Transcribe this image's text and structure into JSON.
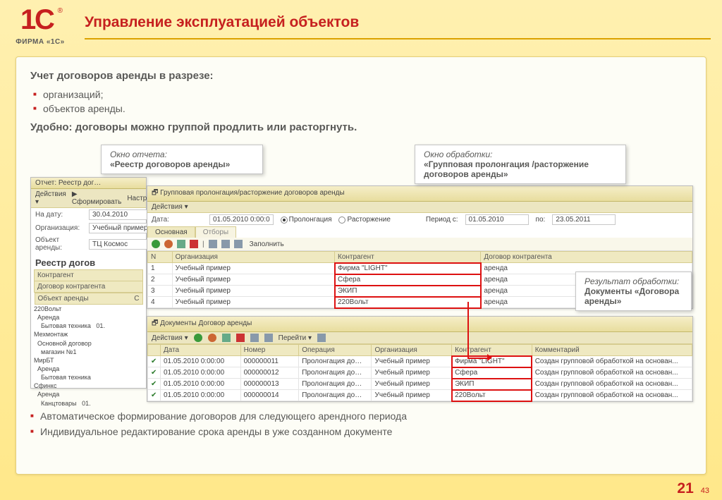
{
  "logo_text": "ФИРМА «1С»",
  "slide_title": "Управление эксплуатацией объектов",
  "intro_heading": "Учет договоров аренды в разрезе:",
  "intro_bullets": [
    "организаций;",
    "объектов аренды."
  ],
  "convenient": "Удобно: договоры можно группой продлить или расторгнуть.",
  "callout1_label": "Окно отчета:",
  "callout1_value": "«Реестр договоров аренды»",
  "callout2_label": "Окно обработки:",
  "callout2_value": "«Групповая пролонгация /расторжение договоров аренды»",
  "callout3_label": "Результат обработки:",
  "callout3_value": "Документы «Договора аренды»",
  "report_win": {
    "title": "Отчет: Реестр дог…",
    "toolbar": [
      "Действия ▾",
      "▶ Сформировать",
      "Настройки"
    ],
    "date_label": "На дату:",
    "date_value": "30.04.2010",
    "org_label": "Организация:",
    "org_value": "Учебный пример",
    "obj_label": "Объект аренды:",
    "obj_value": "ТЦ Космос",
    "heading": "Реестр догов",
    "tree_headers": [
      "Контрагент",
      "Договор контрагента",
      "Объект аренды",
      "С"
    ],
    "tree": [
      "220Вольт",
      "  Аренда",
      "    Бытовая техника   01.",
      "Мехмонтаж",
      "  Основной договор",
      "    магазин №1",
      "МирБТ",
      "  Аренда",
      "    Бытовая техника",
      "Сфинкс",
      "  Аренда",
      "    Канцтовары   01."
    ]
  },
  "proc_win": {
    "title": "Групповая пролонгация/расторжение договоров аренды",
    "toolbar": "Действия ▾",
    "date_label": "Дата:",
    "date_value": "01.05.2010 0:00:0",
    "opt_prolong": "Пролонгация",
    "opt_terminate": "Расторжение",
    "period_from_label": "Период с:",
    "period_from": "01.05.2010",
    "period_to_label": "по:",
    "period_to": "23.05.2011",
    "tab_main": "Основная",
    "tab_filter": "Отборы",
    "fill_label": "Заполнить",
    "headers": [
      "N",
      "Организация",
      "Контрагент",
      "Договор контрагента"
    ],
    "rows": [
      [
        "1",
        "Учебный пример",
        "Фирма \"LIGHT\"",
        "аренда"
      ],
      [
        "2",
        "Учебный пример",
        "Сфера",
        "аренда"
      ],
      [
        "3",
        "Учебный пример",
        "ЭКИП",
        "аренда"
      ],
      [
        "4",
        "Учебный пример",
        "220Вольт",
        "аренда"
      ]
    ]
  },
  "docs_win": {
    "title": "Документы Договор аренды",
    "toolbar": [
      "Действия ▾",
      "Перейти ▾"
    ],
    "headers": [
      "",
      "Дата",
      "Номер",
      "Операция",
      "Организация",
      "Контрагент",
      "Комментарий"
    ],
    "rows": [
      [
        "",
        "01.05.2010 0:00:00",
        "000000011",
        "Пролонгация до…",
        "Учебный пример",
        "Фирма \"LIGHT\"",
        "Создан групповой обработкой на основан..."
      ],
      [
        "",
        "01.05.2010 0:00:00",
        "000000012",
        "Пролонгация до…",
        "Учебный пример",
        "Сфера",
        "Создан групповой обработкой на основан..."
      ],
      [
        "",
        "01.05.2010 0:00:00",
        "000000013",
        "Пролонгация до…",
        "Учебный пример",
        "ЭКИП",
        "Создан групповой обработкой на основан..."
      ],
      [
        "",
        "01.05.2010 0:00:00",
        "000000014",
        "Пролонгация до…",
        "Учебный пример",
        "220Вольт",
        "Создан групповой обработкой на основан..."
      ]
    ]
  },
  "bottom_bullets": [
    "Автоматическое формирование договоров для следующего арендного периода",
    "Индивидуальное редактирование срока аренды в уже созданном документе"
  ],
  "page_num_big": "21",
  "page_num_small": "43"
}
